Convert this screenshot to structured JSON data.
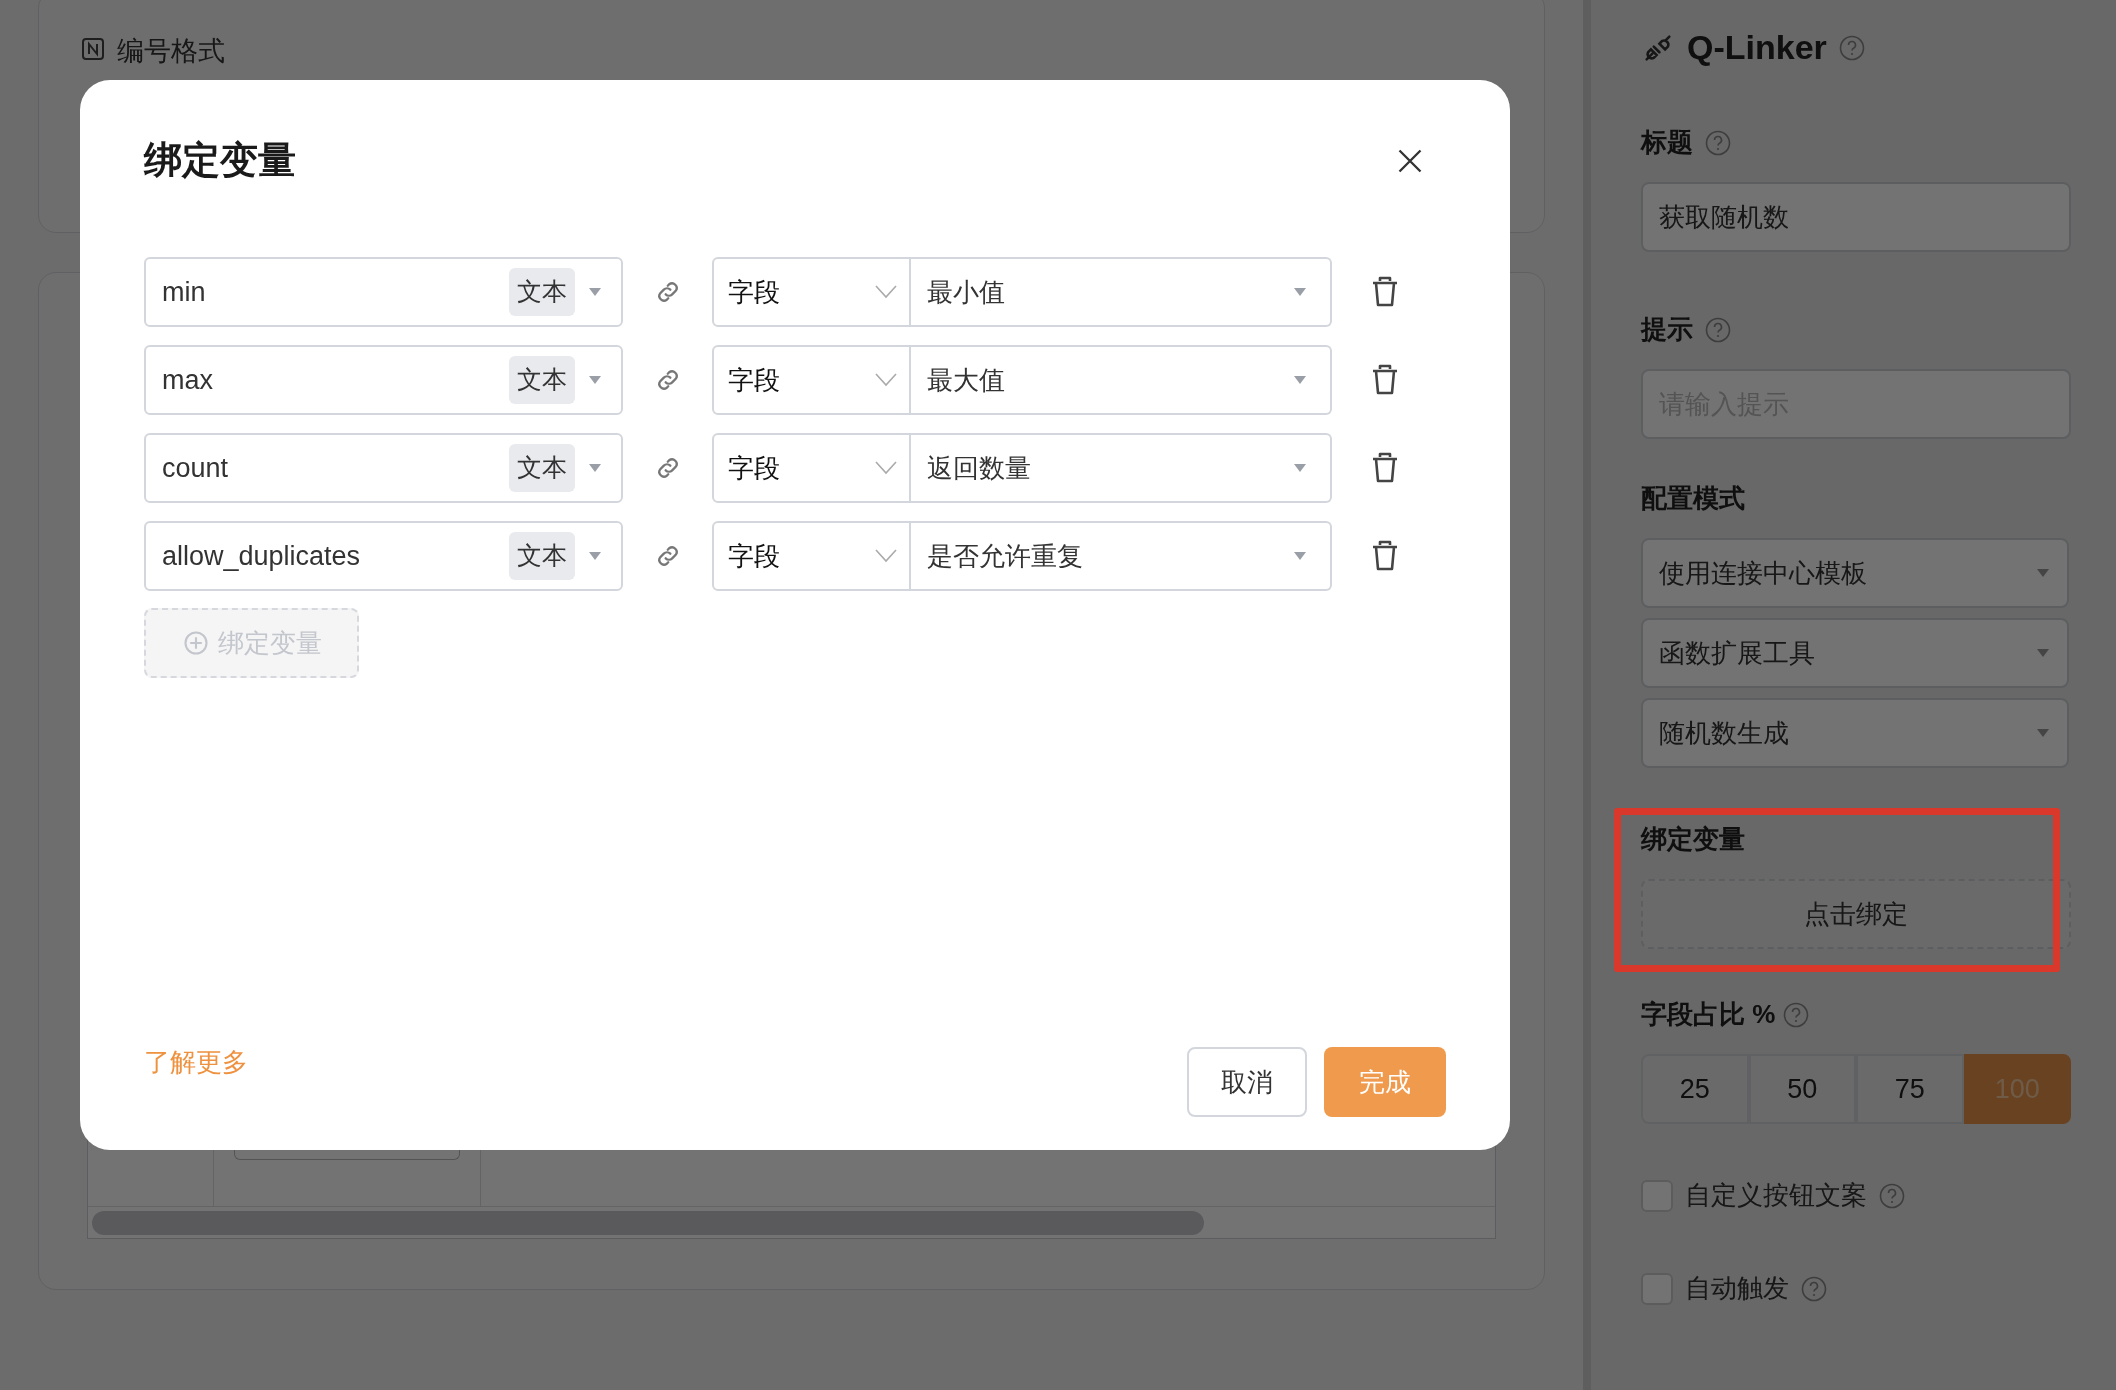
{
  "background": {
    "section_label": "编号格式"
  },
  "panel": {
    "title": "Q-Linker",
    "fields": [
      {
        "label": "标题",
        "value": "获取随机数"
      },
      {
        "label": "提示",
        "placeholder": "请输入提示"
      }
    ],
    "mode": {
      "label": "配置模式",
      "selects": [
        "使用连接中心模板",
        "函数扩展工具",
        "随机数生成"
      ]
    },
    "binding": {
      "label": "绑定变量",
      "button": "点击绑定"
    },
    "ratio": {
      "label": "字段占比 %",
      "options": [
        {
          "label": "25",
          "selected": false
        },
        {
          "label": "50",
          "selected": false
        },
        {
          "label": "75",
          "selected": false
        },
        {
          "label": "100",
          "selected": true
        }
      ]
    },
    "checkboxes": [
      {
        "label": "自定义按钮文案",
        "checked": false
      },
      {
        "label": "自动触发",
        "checked": false
      }
    ]
  },
  "dialog": {
    "title": "绑定变量",
    "rows": [
      {
        "name": "min",
        "type": "文本",
        "source": "字段",
        "field": "最小值"
      },
      {
        "name": "max",
        "type": "文本",
        "source": "字段",
        "field": "最大值"
      },
      {
        "name": "count",
        "type": "文本",
        "source": "字段",
        "field": "返回数量"
      },
      {
        "name": "allow_duplicates",
        "type": "文本",
        "source": "字段",
        "field": "是否允许重复"
      }
    ],
    "add_button": "绑定变量",
    "link": "了解更多",
    "buttons": [
      {
        "label": "取消",
        "kind": "secondary"
      },
      {
        "label": "完成",
        "kind": "primary"
      }
    ]
  }
}
